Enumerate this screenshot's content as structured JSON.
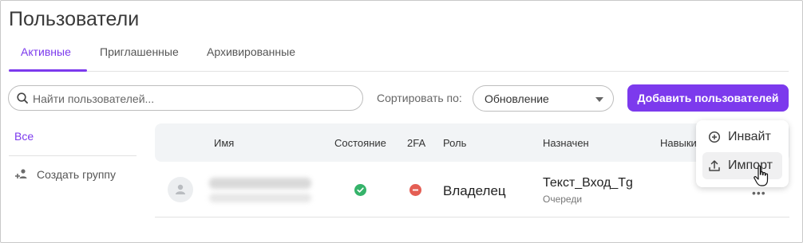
{
  "page_title": "Пользователи",
  "tabs": [
    {
      "label": "Активные",
      "active": true
    },
    {
      "label": "Приглашенные",
      "active": false
    },
    {
      "label": "Архивированные",
      "active": false
    }
  ],
  "search": {
    "placeholder": "Найти пользователей...",
    "value": ""
  },
  "sort": {
    "label": "Сортировать по:",
    "selected": "Обновление"
  },
  "add_button_label": "Добавить пользователей",
  "sidebar": {
    "all_label": "Все",
    "create_group_label": "Создать группу"
  },
  "table": {
    "columns": [
      "Имя",
      "Состояние",
      "2FA",
      "Роль",
      "Назначен",
      "Навыки"
    ],
    "rows": [
      {
        "status_icon": "check-circle-icon",
        "twofa_icon": "minus-circle-icon",
        "role": "Владелец",
        "assigned": "Текст_Вход_Tg",
        "assigned_sub": "Очереди"
      }
    ]
  },
  "dropdown_menu": {
    "items": [
      {
        "label": "Инвайт",
        "icon": "plus-circle-icon"
      },
      {
        "label": "Импорт",
        "icon": "upload-icon",
        "highlighted": true
      }
    ]
  },
  "colors": {
    "accent": "#7c3aed",
    "success": "#35b36a",
    "danger": "#e45e54"
  }
}
